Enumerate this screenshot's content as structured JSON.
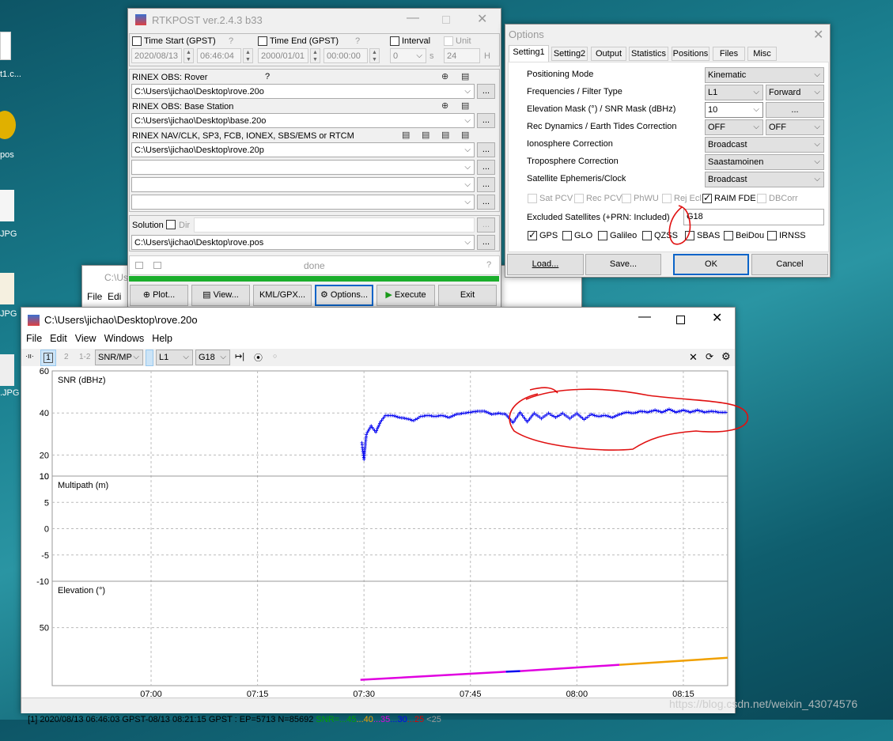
{
  "desktop": {
    "icons": [
      {
        "label": "t1.c..."
      },
      {
        "label": "pos"
      },
      {
        "label": "JPG"
      },
      {
        "label": "JPG"
      },
      {
        "label": ".JPG"
      }
    ],
    "behind_window": {
      "title": "C:\\Us",
      "menu": "File  Edi"
    }
  },
  "rtkpost": {
    "title": "RTKPOST ver.2.4.3 b33",
    "time_start": {
      "label": "Time Start (GPST)",
      "help": "?",
      "date": "2020/08/13",
      "time": "06:46:04",
      "checked": false
    },
    "time_end": {
      "label": "Time End (GPST)",
      "help": "?",
      "date": "2000/01/01",
      "time": "00:00:00",
      "checked": false
    },
    "interval": {
      "label": "Interval",
      "value": "0",
      "unit": "s",
      "checked": false
    },
    "unit": {
      "label": "Unit",
      "value": "24",
      "unit": "H",
      "checked": false
    },
    "rover": {
      "label": "RINEX OBS: Rover",
      "help": "?",
      "path": "C:\\Users\\jichao\\Desktop\\rove.20o"
    },
    "base": {
      "label": "RINEX OBS: Base Station",
      "path": "C:\\Users\\jichao\\Desktop\\base.20o"
    },
    "nav": {
      "label": "RINEX NAV/CLK, SP3, FCB, IONEX, SBS/EMS  or RTCM",
      "paths": [
        "C:\\Users\\jichao\\Desktop\\rove.20p",
        "",
        "",
        ""
      ]
    },
    "solution": {
      "label": "Solution",
      "dir_label": "Dir",
      "dir": "",
      "path": "C:\\Users\\jichao\\Desktop\\rove.pos"
    },
    "browse": "...",
    "status": {
      "text": "done",
      "help": "?",
      "progress": 100,
      "color": "#1bae2c"
    },
    "buttons": {
      "plot": "Plot...",
      "view": "View...",
      "kml": "KML/GPX...",
      "options": "Options...",
      "execute": "Execute",
      "exit": "Exit"
    }
  },
  "options": {
    "title": "Options",
    "tabs": [
      "Setting1",
      "Setting2",
      "Output",
      "Statistics",
      "Positions",
      "Files",
      "Misc"
    ],
    "active_tab": "Setting1",
    "rows": [
      {
        "label": "Positioning Mode",
        "values": [
          "Kinematic"
        ]
      },
      {
        "label": "Frequencies / Filter Type",
        "values": [
          "L1",
          "Forward"
        ]
      },
      {
        "label": "Elevation Mask (°) / SNR Mask (dBHz)",
        "values": [
          "10",
          "..."
        ]
      },
      {
        "label": "Rec Dynamics / Earth Tides Correction",
        "values": [
          "OFF",
          "OFF"
        ]
      },
      {
        "label": "Ionosphere Correction",
        "values": [
          "Broadcast"
        ]
      },
      {
        "label": "Troposphere Correction",
        "values": [
          "Saastamoinen"
        ]
      },
      {
        "label": "Satellite Ephemeris/Clock",
        "values": [
          "Broadcast"
        ]
      }
    ],
    "flags": [
      {
        "label": "Sat PCV",
        "checked": false,
        "enabled": false
      },
      {
        "label": "Rec PCV",
        "checked": false,
        "enabled": false
      },
      {
        "label": "PhWU",
        "checked": false,
        "enabled": false
      },
      {
        "label": "Rej Ecl",
        "checked": false,
        "enabled": false
      },
      {
        "label": "RAIM FDE",
        "checked": true,
        "enabled": true
      },
      {
        "label": "DBCorr",
        "checked": false,
        "enabled": false
      }
    ],
    "excluded": {
      "label": "Excluded Satellites (+PRN: Included)",
      "value": "G18"
    },
    "systems": [
      {
        "label": "GPS",
        "checked": true
      },
      {
        "label": "GLO",
        "checked": false
      },
      {
        "label": "Galileo",
        "checked": false
      },
      {
        "label": "QZSS",
        "checked": false
      },
      {
        "label": "SBAS",
        "checked": false
      },
      {
        "label": "BeiDou",
        "checked": false
      },
      {
        "label": "IRNSS",
        "checked": false
      }
    ],
    "buttons": {
      "load": "Load...",
      "save": "Save...",
      "ok": "OK",
      "cancel": "Cancel"
    }
  },
  "plot": {
    "title": "C:\\Users\\jichao\\Desktop\\rove.20o",
    "menu": [
      "File",
      "Edit",
      "View",
      "Windows",
      "Help"
    ],
    "toolbar": {
      "btn1": "1",
      "btn2": "2",
      "btn12": "1-2",
      "type": "SNR/MP",
      "freq": "L1",
      "sat": "G18"
    },
    "status": {
      "prefix": "[1] 2020/08/13 06:46:03 GPST-08/13 08:21:15 GPST : EP=5713 N=85692 ",
      "snr": "SNR=...45",
      "l40": "...40",
      "l35": "...35",
      "l30": "...30",
      "l25": "...25",
      "lt25": "<25",
      "colors": {
        "snr": "#00a000",
        "l40": "#f0a000",
        "l35": "#e000e0",
        "l30": "#0000f0",
        "l25": "#e00000",
        "lt25": "#999999"
      }
    },
    "watermark": "https://blog.csdn.net/weixin_43074576"
  },
  "chart_data": {
    "type": "scatter",
    "x_ticks": [
      "07:00",
      "07:15",
      "07:30",
      "07:45",
      "08:00",
      "08:15"
    ],
    "x_range": [
      "06:46:04",
      "08:21:15"
    ],
    "grid": true,
    "panels": [
      {
        "label": "SNR (dBHz)",
        "ylim": [
          10,
          60
        ],
        "y_ticks": [
          60,
          40,
          20,
          10
        ],
        "color": "#0000f0",
        "points": [
          [
            "07:29:40",
            27
          ],
          [
            "07:29:50",
            22
          ],
          [
            "07:30:00",
            18
          ],
          [
            "07:30:20",
            30
          ],
          [
            "07:31:00",
            34
          ],
          [
            "07:31:40",
            31
          ],
          [
            "07:32:20",
            36
          ],
          [
            "07:33:00",
            39
          ],
          [
            "07:34:00",
            39
          ],
          [
            "07:35:00",
            38
          ],
          [
            "07:36:00",
            37.5
          ],
          [
            "07:37:00",
            36.5
          ],
          [
            "07:38:00",
            38.5
          ],
          [
            "07:39:00",
            39
          ],
          [
            "07:40:00",
            38.5
          ],
          [
            "07:41:00",
            39
          ],
          [
            "07:42:00",
            38
          ],
          [
            "07:43:00",
            39.5
          ],
          [
            "07:44:00",
            40
          ],
          [
            "07:45:00",
            40.5
          ],
          [
            "07:46:00",
            41
          ],
          [
            "07:47:00",
            41
          ],
          [
            "07:48:00",
            39.5
          ],
          [
            "07:49:00",
            40
          ],
          [
            "07:50:00",
            39.5
          ],
          [
            "07:51:00",
            35.5
          ],
          [
            "07:52:00",
            40.5
          ],
          [
            "07:53:00",
            36
          ],
          [
            "07:54:00",
            40
          ],
          [
            "07:55:00",
            37.5
          ],
          [
            "07:56:00",
            40
          ],
          [
            "07:57:00",
            38
          ],
          [
            "07:58:00",
            40
          ],
          [
            "07:59:00",
            37.5
          ],
          [
            "08:00:00",
            40
          ],
          [
            "08:01:00",
            37
          ],
          [
            "08:02:00",
            39.5
          ],
          [
            "08:03:00",
            38.5
          ],
          [
            "08:04:00",
            39
          ],
          [
            "08:05:00",
            38
          ],
          [
            "08:06:00",
            39.5
          ],
          [
            "08:07:00",
            40.5
          ],
          [
            "08:08:00",
            40
          ],
          [
            "08:09:00",
            41
          ],
          [
            "08:10:00",
            40.5
          ],
          [
            "08:11:00",
            41.5
          ],
          [
            "08:12:00",
            40.5
          ],
          [
            "08:13:00",
            42
          ],
          [
            "08:14:00",
            40.5
          ],
          [
            "08:15:00",
            41.5
          ],
          [
            "08:16:00",
            40.5
          ],
          [
            "08:17:00",
            41.5
          ],
          [
            "08:18:00",
            40.5
          ],
          [
            "08:19:00",
            41
          ],
          [
            "08:20:00",
            40.5
          ],
          [
            "08:21:00",
            40.5
          ]
        ]
      },
      {
        "label": "Multipath (m)",
        "ylim": [
          -10,
          10
        ],
        "y_ticks": [
          10,
          5,
          0,
          -5,
          -10
        ],
        "points": []
      },
      {
        "label": "Elevation (°)",
        "ylim": [
          0,
          90
        ],
        "y_ticks": [
          50
        ],
        "points": [
          [
            "07:29:30",
            5,
            "#e000e0"
          ],
          [
            "07:50:00",
            12,
            "#0000f0"
          ],
          [
            "07:52:00",
            12.5,
            "#e000e0"
          ],
          [
            "08:06:00",
            18,
            "#f0a000"
          ],
          [
            "08:21:15",
            24,
            "#f0a000"
          ]
        ]
      }
    ]
  },
  "annotations": {
    "color": "#e01010"
  }
}
